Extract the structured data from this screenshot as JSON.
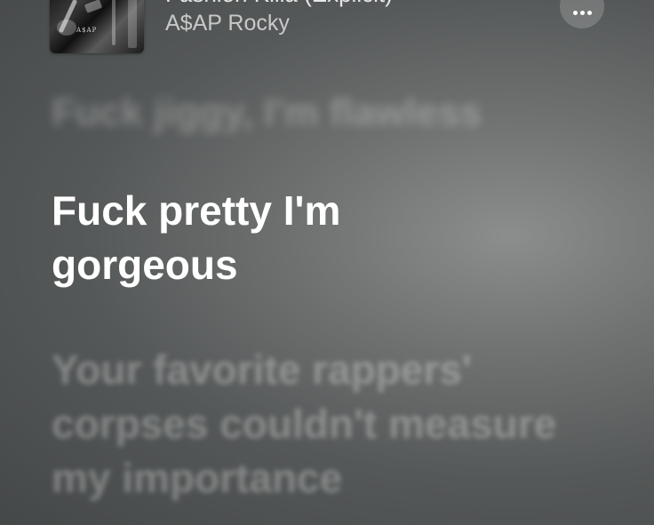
{
  "now_playing": {
    "title": "Fashion Killa (Explicit)",
    "artist": "A$AP Rocky",
    "artwork_text": "A$AP"
  },
  "controls": {
    "more_icon": "ellipsis-icon"
  },
  "lyrics": {
    "previous": "Fuck jiggy, I'm flawless",
    "current": "Fuck pretty I'm gorgeous",
    "next": "Your favorite rappers' corpses couldn't measure my importance"
  },
  "colors": {
    "background": "#5a5d5d",
    "text_active": "#ffffff"
  }
}
